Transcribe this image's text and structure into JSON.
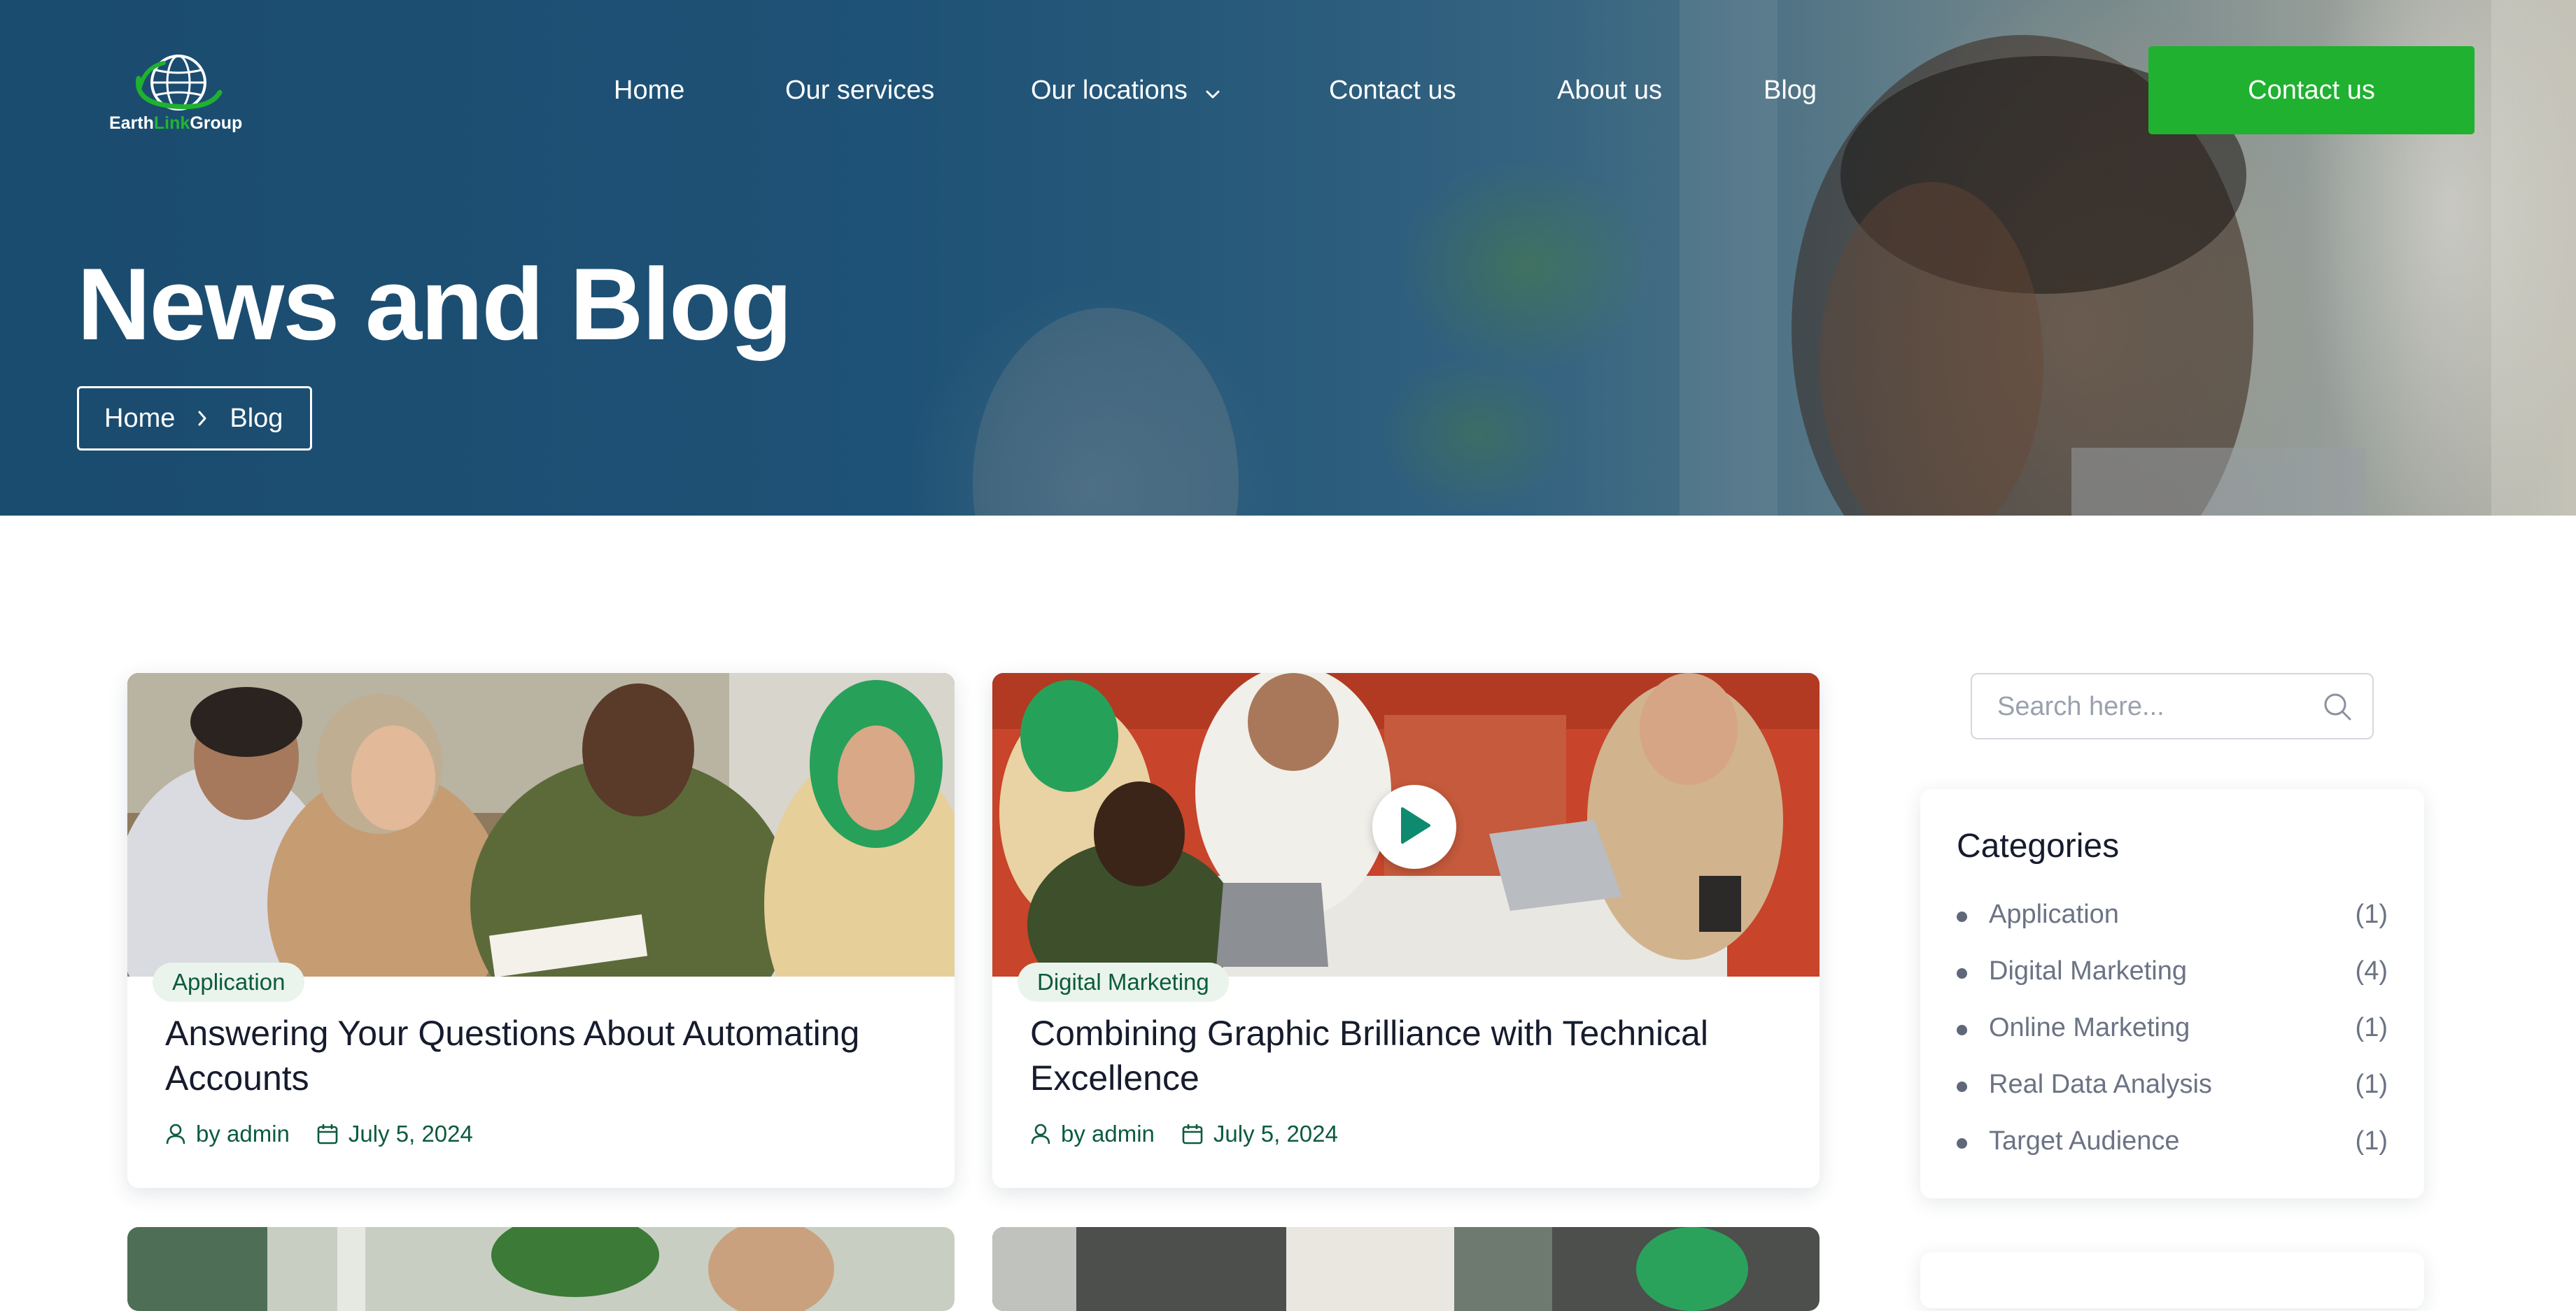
{
  "brand": {
    "logo_text_a": "Earth",
    "logo_text_b": "Link",
    "logo_text_c": "Group",
    "accent_green": "#1fb12f",
    "dark_green": "#0c5b3c",
    "hero_blue": "#1f5275"
  },
  "nav": {
    "items": [
      {
        "label": "Home"
      },
      {
        "label": "Our services"
      },
      {
        "label": "Our locations",
        "has_dropdown": true
      },
      {
        "label": "Contact us"
      },
      {
        "label": "About us"
      },
      {
        "label": "Blog"
      }
    ],
    "cta_label": "Contact us"
  },
  "hero": {
    "title": "News and Blog",
    "breadcrumb": [
      "Home",
      "Blog"
    ]
  },
  "posts": [
    {
      "category": "Application",
      "title": "Answering Your Questions About Automating Accounts",
      "author": "by admin",
      "date": "July 5, 2024",
      "has_video": false
    },
    {
      "category": "Digital Marketing",
      "title": "Combining Graphic Brilliance with Technical Excellence",
      "author": "by admin",
      "date": "July 5, 2024",
      "has_video": true
    }
  ],
  "sidebar": {
    "search_placeholder": "Search here...",
    "categories_title": "Categories",
    "categories": [
      {
        "name": "Application",
        "count": "(1)"
      },
      {
        "name": "Digital Marketing",
        "count": "(4)"
      },
      {
        "name": "Online Marketing",
        "count": "(1)"
      },
      {
        "name": "Real Data Analysis",
        "count": "(1)"
      },
      {
        "name": "Target Audience",
        "count": "(1)"
      }
    ]
  }
}
